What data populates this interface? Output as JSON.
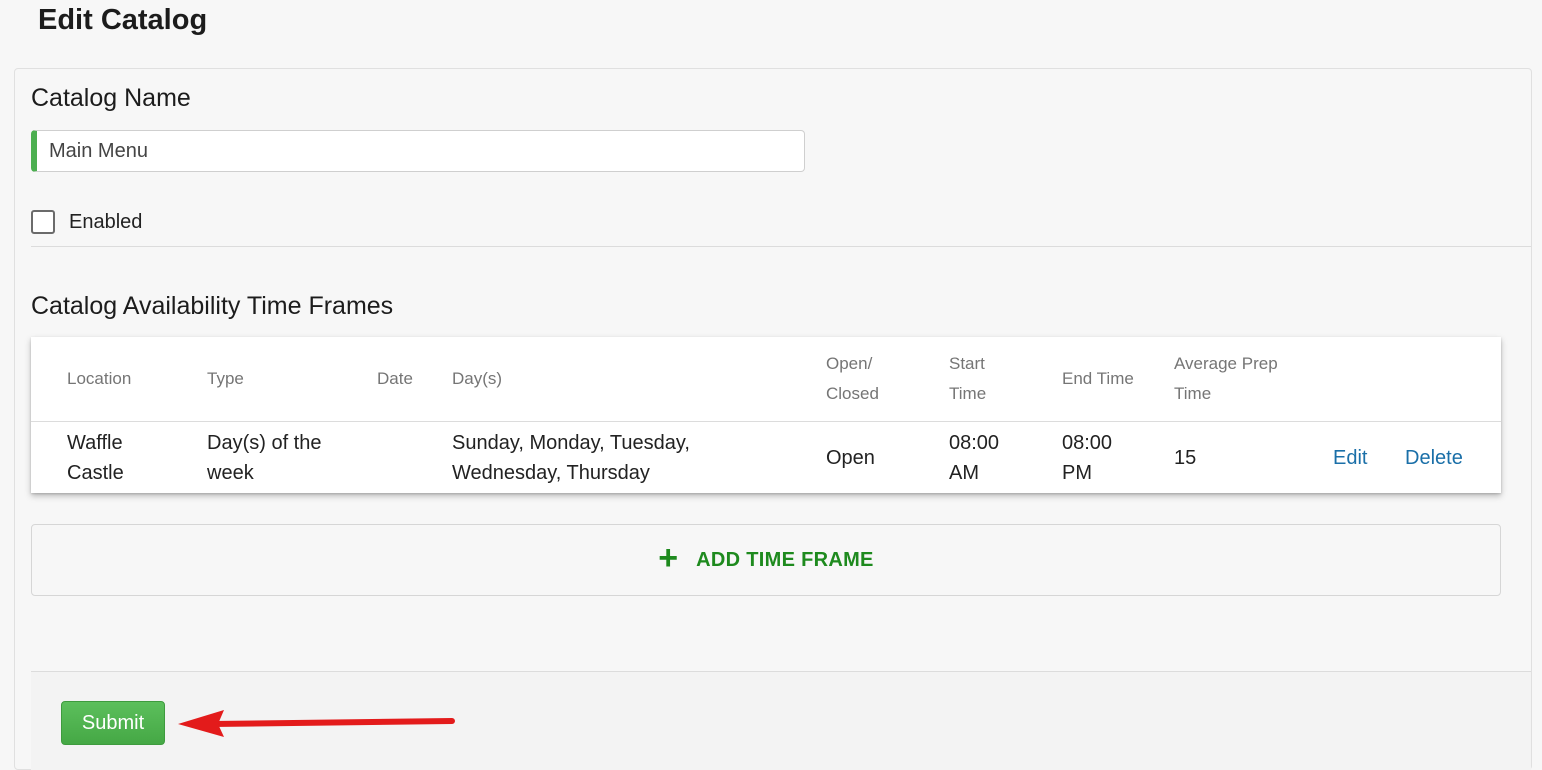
{
  "page": {
    "title": "Edit Catalog"
  },
  "form": {
    "catalog_name_label": "Catalog Name",
    "catalog_name_value": "Main Menu",
    "enabled_label": "Enabled",
    "enabled_checked": false,
    "time_frames_label": "Catalog Availability Time Frames"
  },
  "table": {
    "headers": {
      "location": "Location",
      "type": "Type",
      "date": "Date",
      "days": "Day(s)",
      "open_closed_line1": "Open/",
      "open_closed_line2": "Closed",
      "start_time_line1": "Start",
      "start_time_line2": "Time",
      "end_time": "End Time",
      "avg_prep_line1": "Average Prep",
      "avg_prep_line2": "Time"
    },
    "rows": [
      {
        "location_line1": "Waffle",
        "location_line2": "Castle",
        "type_line1": "Day(s) of the",
        "type_line2": "week",
        "date": "",
        "days_line1": "Sunday, Monday, Tuesday,",
        "days_line2": "Wednesday, Thursday",
        "open_closed": "Open",
        "start_line1": "08:00",
        "start_line2": "AM",
        "end_line1": "08:00",
        "end_line2": "PM",
        "avg_prep": "15",
        "edit_label": "Edit",
        "delete_label": "Delete"
      }
    ]
  },
  "actions": {
    "add_time_frame_label": "ADD TIME FRAME",
    "submit_label": "Submit"
  },
  "colors": {
    "accent_green": "#1e8a1e",
    "submit_green": "#4cae4c",
    "link_blue": "#1a6fa8",
    "annotation_arrow": "#e31b1b"
  }
}
